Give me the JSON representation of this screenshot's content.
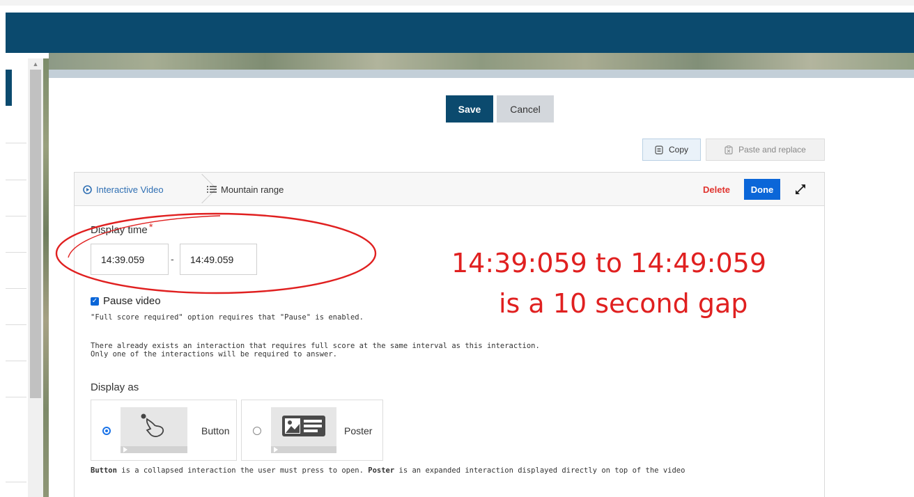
{
  "toolbar": {
    "save_label": "Save",
    "cancel_label": "Cancel",
    "copy_label": "Copy",
    "paste_label": "Paste and replace"
  },
  "breadcrumb": {
    "root_label": "Interactive Video",
    "current_label": "Mountain range",
    "delete_label": "Delete",
    "done_label": "Done"
  },
  "display_time": {
    "label": "Display time",
    "required_mark": "*",
    "start_value": "14:39.059",
    "separator": "-",
    "end_value": "14:49.059"
  },
  "pause": {
    "label": "Pause video",
    "checked": true,
    "note": "\"Full score required\" option requires that \"Pause\" is enabled.",
    "warning_line1": "There already exists an interaction that requires full score at the same interval as this interaction.",
    "warning_line2": "Only one of the interactions will be required to answer."
  },
  "display_as": {
    "label": "Display as",
    "options": [
      {
        "label": "Button",
        "selected": true,
        "icon": "hand-pointer-icon"
      },
      {
        "label": "Poster",
        "selected": false,
        "icon": "poster-icon"
      }
    ],
    "desc_button": "Button",
    "desc_mid": " is a collapsed interaction the user must press to open. ",
    "desc_poster": "Poster",
    "desc_end": " is an expanded interaction displayed directly on top of the video"
  },
  "annotation": {
    "line1": "14:39:059  to 14:49:059",
    "line2": "is a 10 second gap",
    "color": "#e02020"
  },
  "colors": {
    "header": "#0b4a6e",
    "primary_button": "#0b4a6e",
    "done_button": "#0b66d8",
    "delete_text": "#e0342f",
    "link": "#2f6fb3"
  }
}
